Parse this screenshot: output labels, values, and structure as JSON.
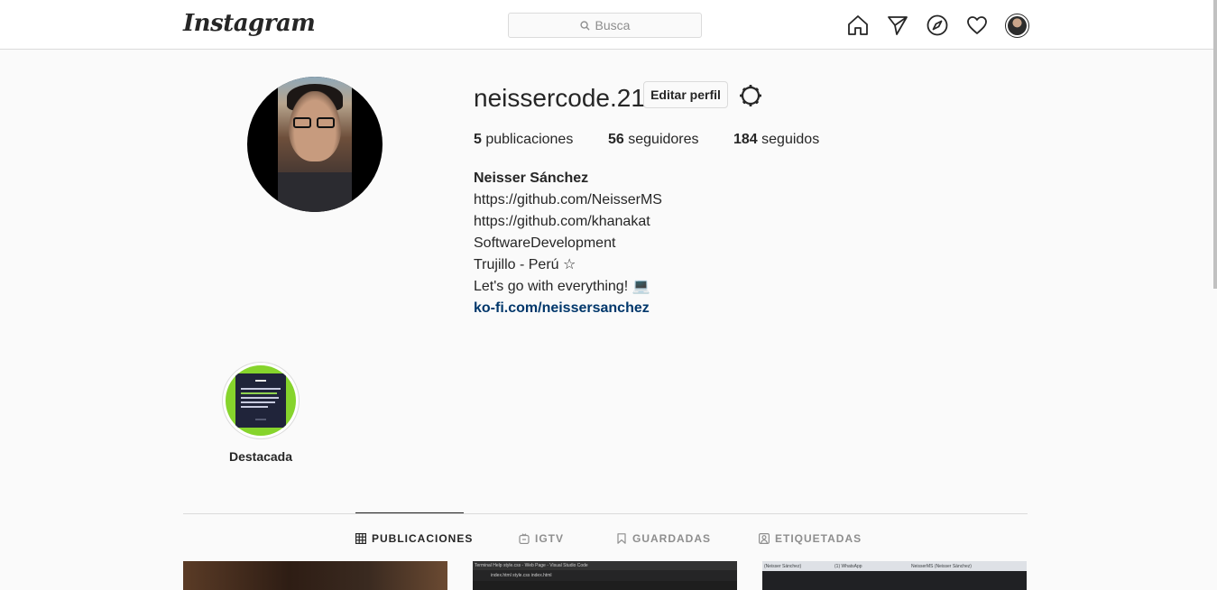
{
  "header": {
    "logo": "Instagram",
    "search_placeholder": "Busca"
  },
  "profile": {
    "username": "neissercode.21",
    "edit_label": "Editar perfil",
    "stats": {
      "posts_count": "5",
      "posts_label": "publicaciones",
      "followers_count": "56",
      "followers_label": "seguidores",
      "following_count": "184",
      "following_label": "seguidos"
    },
    "bio": {
      "full_name": "Neisser Sánchez",
      "lines": [
        "https://github.com/NeisserMS",
        "https://github.com/khanakat",
        "SoftwareDevelopment",
        "Trujillo - Perú ☆",
        "Let's go with everything! 💻"
      ],
      "website": "ko-fi.com/neissersanchez"
    }
  },
  "highlight": {
    "label": "Destacada"
  },
  "tabs": [
    {
      "label": "PUBLICACIONES",
      "icon": "grid-icon",
      "active": true
    },
    {
      "label": "IGTV",
      "icon": "igtv-icon",
      "active": false
    },
    {
      "label": "GUARDADAS",
      "icon": "bookmark-icon",
      "active": false
    },
    {
      "label": "ETIQUETADAS",
      "icon": "tagged-icon",
      "active": false
    }
  ],
  "posts": {
    "post2_text": "Terminal   Help        style.css - Web Page - Visual Studio Code",
    "post2_tabs": "index.html    style.css    index.html",
    "post3_tab1": "(Neisser Sánchez)",
    "post3_tab2": "(1) WhatsApp",
    "post3_tab3": "NeisserMS (Neisser Sánchez)"
  },
  "colors": {
    "link": "#00376b",
    "text": "#262626",
    "secondary": "#8e8e8e",
    "border": "#dbdbdb",
    "highlight_bg": "#86d42c"
  }
}
